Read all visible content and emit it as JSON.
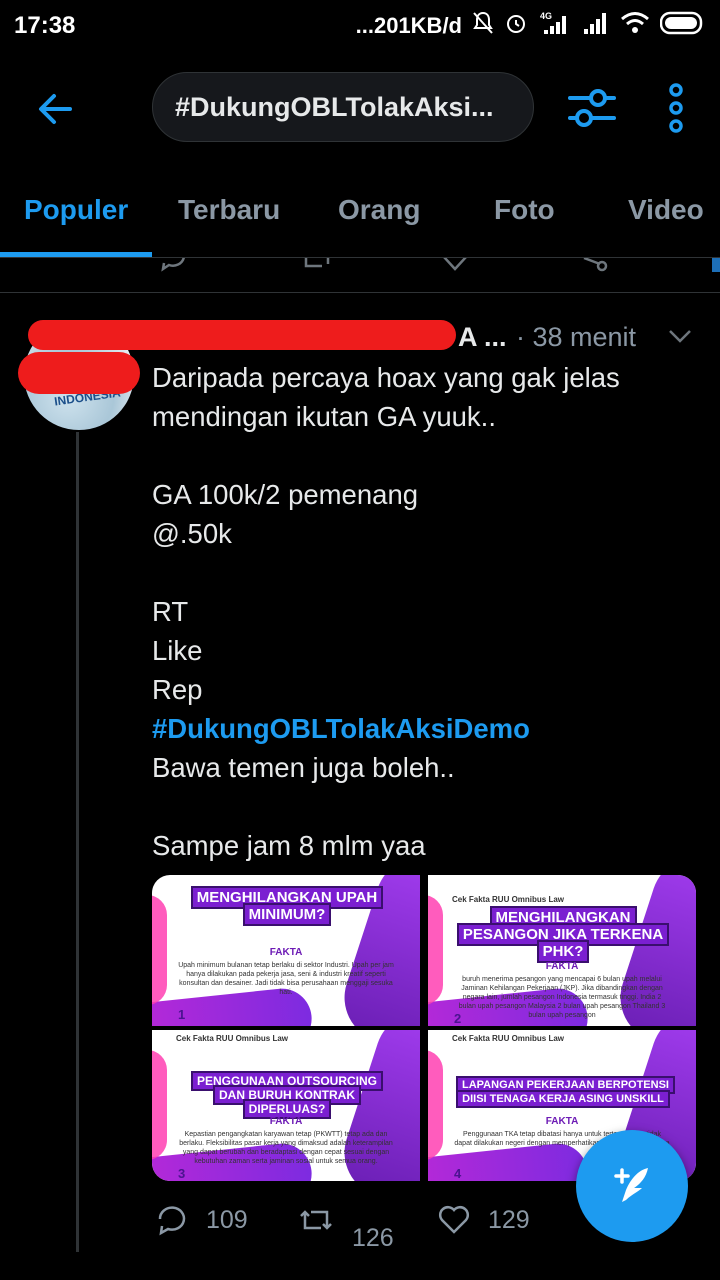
{
  "status_bar": {
    "time": "17:38",
    "speed": "...201KB/d",
    "network_label": "4G"
  },
  "header": {
    "search_query": "#DukungOBLTolakAksi...",
    "icons": [
      "back-arrow-icon",
      "filter-sliders-icon",
      "more-vertical-icon"
    ]
  },
  "tabs": [
    {
      "label": "Populer",
      "active": true
    },
    {
      "label": "Terbaru",
      "active": false
    },
    {
      "label": "Orang",
      "active": false
    },
    {
      "label": "Foto",
      "active": false
    },
    {
      "label": "Video",
      "active": false
    }
  ],
  "tweet": {
    "name_tail": "A ...",
    "time": "· 38 menit",
    "lines": [
      "Daripada percaya hoax yang gak jelas",
      "mendingan ikutan GA yuuk..",
      "",
      "GA 100k/2 pemenang",
      "@.50k",
      "",
      "RT",
      "Like",
      "Rep",
      "#DukungOBLTolakAksiDemo",
      "Bawa temen juga boleh..",
      "",
      "Sampe jam 8 mlm yaa"
    ],
    "hashtag_line_index": 9,
    "avatar_text": "INDONESIA",
    "images": [
      {
        "stamp": "",
        "headline": "MENGHILANGKAN UPAH MINIMUM?",
        "fakta": "FAKTA",
        "body": "Upah minimum bulanan tetap berlaku di sektor Industri. Upah per jam hanya dilakukan pada pekerja jasa, seni & industri kreatif seperti konsultan dan desainer. Jadi tidak bisa perusahaan menggaji sesuka hati.",
        "number": "1"
      },
      {
        "stamp": "Cek Fakta RUU Omnibus Law",
        "headline": "MENGHILANGKAN PESANGON JIKA TERKENA PHK?",
        "fakta": "FAKTA",
        "body": "buruh menerima pesangon yang mencapai 6 bulan upah melalui Jaminan Kehilangan Pekerjaan (JKP). Jika dibandingkan dengan negara lain, jumlah pesangon Indonesia termasuk tinggi. India 2 bulan upah pesangon Malaysia 2 bulan upah pesangon Thailand 3 bulan upah pesangon",
        "number": "2"
      },
      {
        "stamp": "Cek Fakta RUU Omnibus Law",
        "headline": "PENGGUNAAN OUTSOURCING DAN BURUH KONTRAK DIPERLUAS?",
        "fakta": "FAKTA",
        "body": "Kepastian pengangkatan karyawan tetap (PKWTT) tetap ada dan berlaku. Fleksibilitas pasar kerja yang dimaksud adalah keterampilan yang dapat berubah dan beradaptasi dengan cepat sesuai dengan kebutuhan zaman serta jaminan sosial untuk semua orang.",
        "number": "3"
      },
      {
        "stamp": "Cek Fakta RUU Omnibus Law",
        "headline": "LAPANGAN PEKERJAAN BERPOTENSI DIISI TENAGA KERJA ASING UNSKILL",
        "fakta": "FAKTA",
        "body": "Penggunaan TKA tetap dibatasi hanya untuk tertentu yang tidak dapat dilakukan negeri dengan memperhatikan jenis kompetensi jaba",
        "number": "4"
      }
    ],
    "actions": {
      "replies": "109",
      "retweets": "126",
      "likes": "129"
    }
  },
  "colors": {
    "accent": "#1d9bf0",
    "background": "#000000",
    "muted": "#8b98a5",
    "redaction": "#ee1c1c"
  }
}
